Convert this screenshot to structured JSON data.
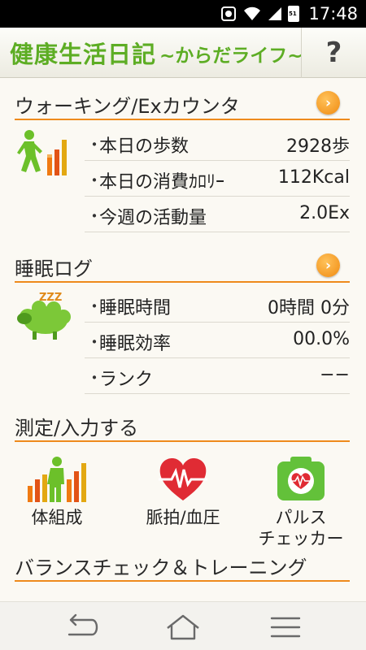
{
  "status": {
    "time": "17:48",
    "battery_level": "51"
  },
  "header": {
    "title": "健康生活日記",
    "subtitle": "~からだライフ~",
    "help_label": "?"
  },
  "walking": {
    "title": "ウォーキング/Exカウンタ",
    "rows": [
      {
        "label": "本日の歩数",
        "value": "2928歩"
      },
      {
        "label": "本日の消費ｶﾛﾘｰ",
        "value": "112Kcal"
      },
      {
        "label": "今週の活動量",
        "value": "2.0Ex"
      }
    ]
  },
  "sleep": {
    "title": "睡眠ログ",
    "zzz": "ZZZ",
    "rows": [
      {
        "label": "睡眠時間",
        "value": "0時間 0分"
      },
      {
        "label": "睡眠効率",
        "value": "00.0%"
      },
      {
        "label": "ランク",
        "value": "−−"
      }
    ]
  },
  "measure": {
    "title": "測定/入力する",
    "tiles": [
      {
        "label": "体組成",
        "label2": ""
      },
      {
        "label": "脈拍/血圧",
        "label2": ""
      },
      {
        "label": "パルス",
        "label2": "チェッカー"
      }
    ]
  },
  "balance": {
    "title": "バランスチェック＆トレーニング"
  },
  "icons": {
    "walker": "walker-bars-icon",
    "sheep": "sheep-icon",
    "heart": "heart-pulse-icon",
    "camera": "pulse-camera-icon",
    "back": "back-icon",
    "home": "home-icon",
    "menu": "menu-icon"
  },
  "colors": {
    "accent_green": "#5dad24",
    "accent_orange": "#ee8a1c"
  }
}
